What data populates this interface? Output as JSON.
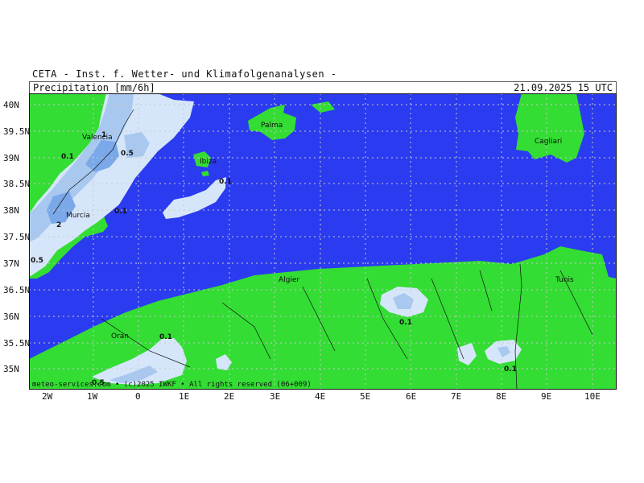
{
  "header": {
    "source": "CETA - Inst. f. Wetter- und Klimafolgenanalysen -",
    "product": "Precipitation [mm/6h]",
    "valid_time": "21.09.2025 15 UTC"
  },
  "map": {
    "footer": "meteo-services.com  •  (c)2025 IWKF  •  All rights reserved (06+009)",
    "x_ticks": [
      "2W",
      "1W",
      "0",
      "1E",
      "2E",
      "3E",
      "4E",
      "5E",
      "6E",
      "7E",
      "8E",
      "9E",
      "10E"
    ],
    "y_ticks": [
      "40N",
      "39.5N",
      "39N",
      "38.5N",
      "38N",
      "37.5N",
      "37N",
      "36.5N",
      "36N",
      "35.5N",
      "35N"
    ],
    "places": [
      "Valencia",
      "Palma",
      "Ibiza",
      "Murcia",
      "Cagliari",
      "Algier",
      "Tunis",
      "Oran"
    ],
    "contour_labels": [
      "1",
      "0.1",
      "0.5",
      "0.1",
      "0.1",
      "2",
      "0.5",
      "0.1",
      "0.1",
      "0.5",
      "0.1"
    ],
    "colors": {
      "sea": "#2b3bf0",
      "land": "#33dd33",
      "precip_light": "#d6e6fa",
      "precip_mid": "#a8c8f0",
      "precip_heavy": "#7aa8e8",
      "grid": "#c8c8c8"
    }
  }
}
